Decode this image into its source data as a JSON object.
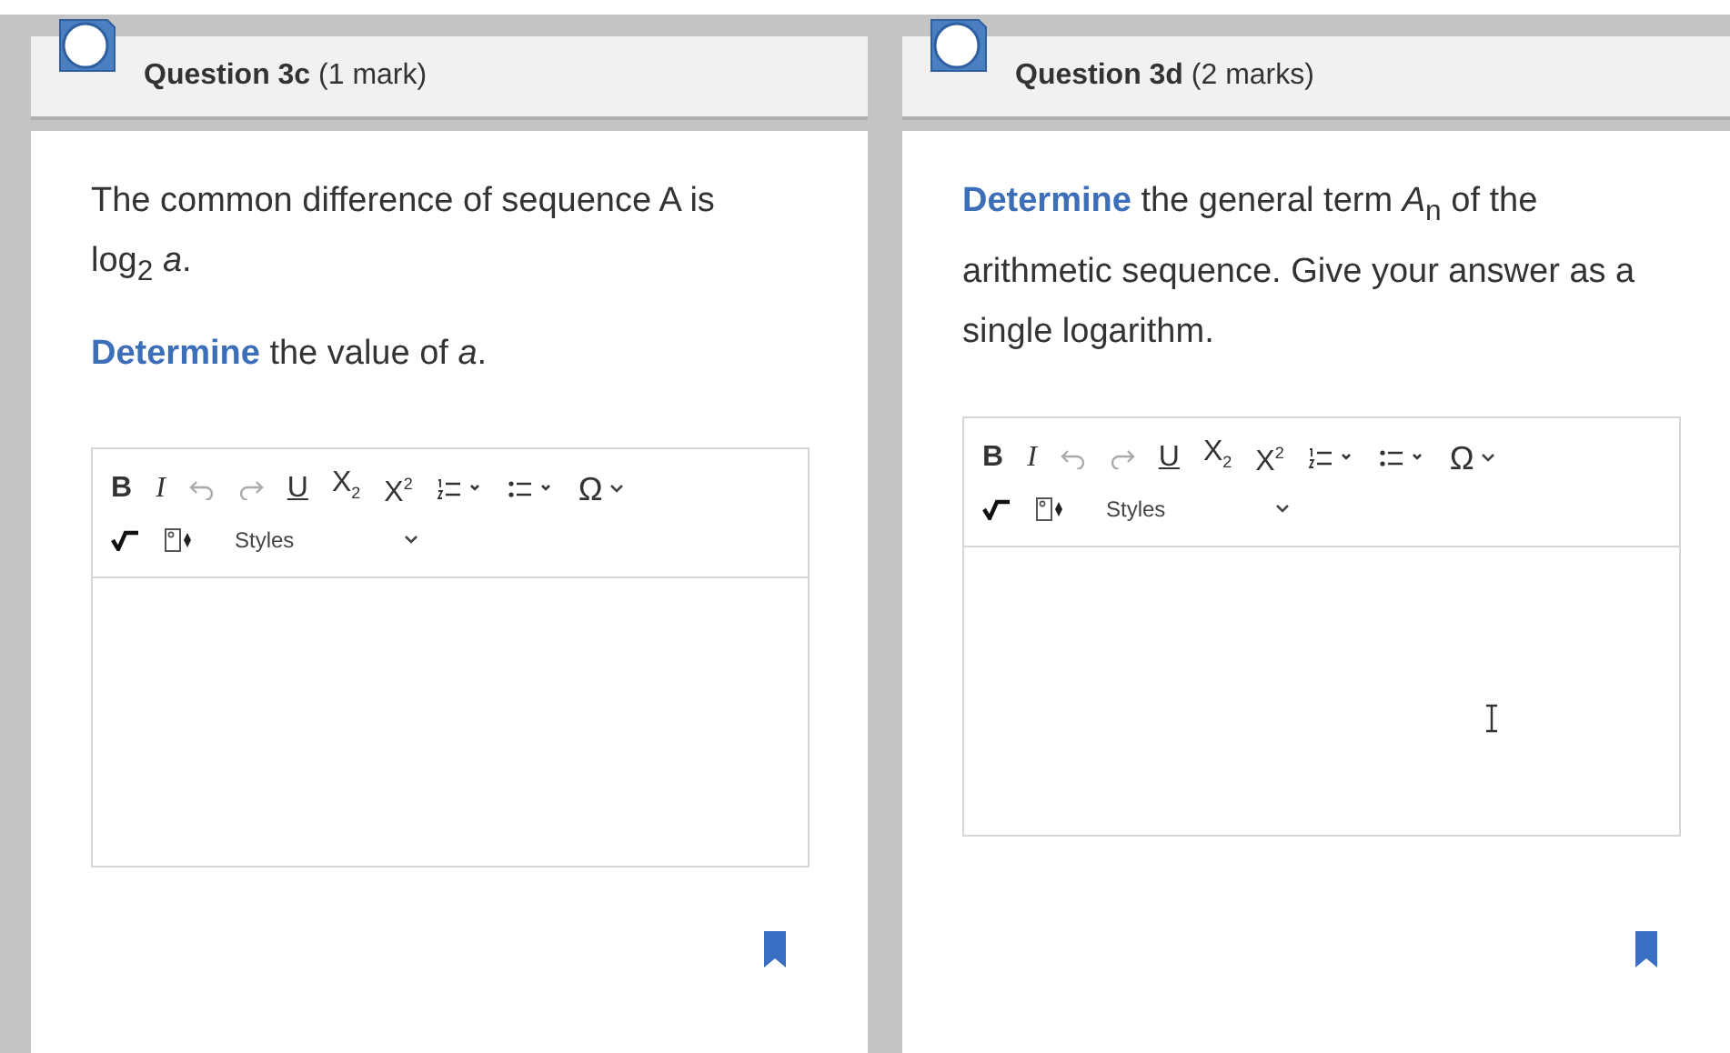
{
  "questions": [
    {
      "number": "Question 3c",
      "marks": "(1 mark)",
      "paragraphs": [
        "The common difference of sequence A is log$_{2}$ *a*.",
        "**Determine** the value of *a*."
      ],
      "editor": {
        "styles": "Styles",
        "toolbar": [
          {
            "kind": "glyph",
            "label": "B",
            "disabled": false
          },
          {
            "kind": "glyph",
            "label": "I",
            "disabled": false
          },
          {
            "kind": "undo",
            "disabled": true
          },
          {
            "kind": "redo",
            "disabled": true
          },
          {
            "kind": "glyph",
            "label": "U",
            "disabled": false
          },
          {
            "kind": "glyph",
            "label": "X$_{2}$",
            "disabled": false
          },
          {
            "kind": "glyph",
            "label": "X$^{2}$",
            "disabled": false
          },
          {
            "kind": "ordered-list",
            "disabled": false
          },
          {
            "kind": "bullet-list",
            "disabled": false
          },
          {
            "kind": "glyph",
            "label": "Ω",
            "disabled": false
          }
        ]
      }
    },
    {
      "number": "Question 3d",
      "marks": "(2 marks)",
      "paragraphs": [
        "**Determine** the general term *A*$_{n}$ of the arithmetic sequence. Give your answer as a single logarithm."
      ],
      "editor": {
        "styles": "Styles",
        "pointer": {
          "kind": "text-cursor"
        },
        "toolbar": [
          {
            "kind": "glyph",
            "label": "B",
            "disabled": false
          },
          {
            "kind": "glyph",
            "label": "I",
            "disabled": false
          },
          {
            "kind": "undo",
            "disabled": true
          },
          {
            "kind": "redo",
            "disabled": true
          },
          {
            "kind": "glyph",
            "label": "U",
            "disabled": false
          },
          {
            "kind": "glyph",
            "label": "X$_{2}$",
            "disabled": false
          },
          {
            "kind": "glyph",
            "label": "X$^{2}$",
            "disabled": false
          },
          {
            "kind": "ordered-list",
            "disabled": false
          },
          {
            "kind": "bullet-list",
            "disabled": false
          },
          {
            "kind": "glyph",
            "label": "Ω",
            "disabled": false
          }
        ]
      }
    }
  ]
}
